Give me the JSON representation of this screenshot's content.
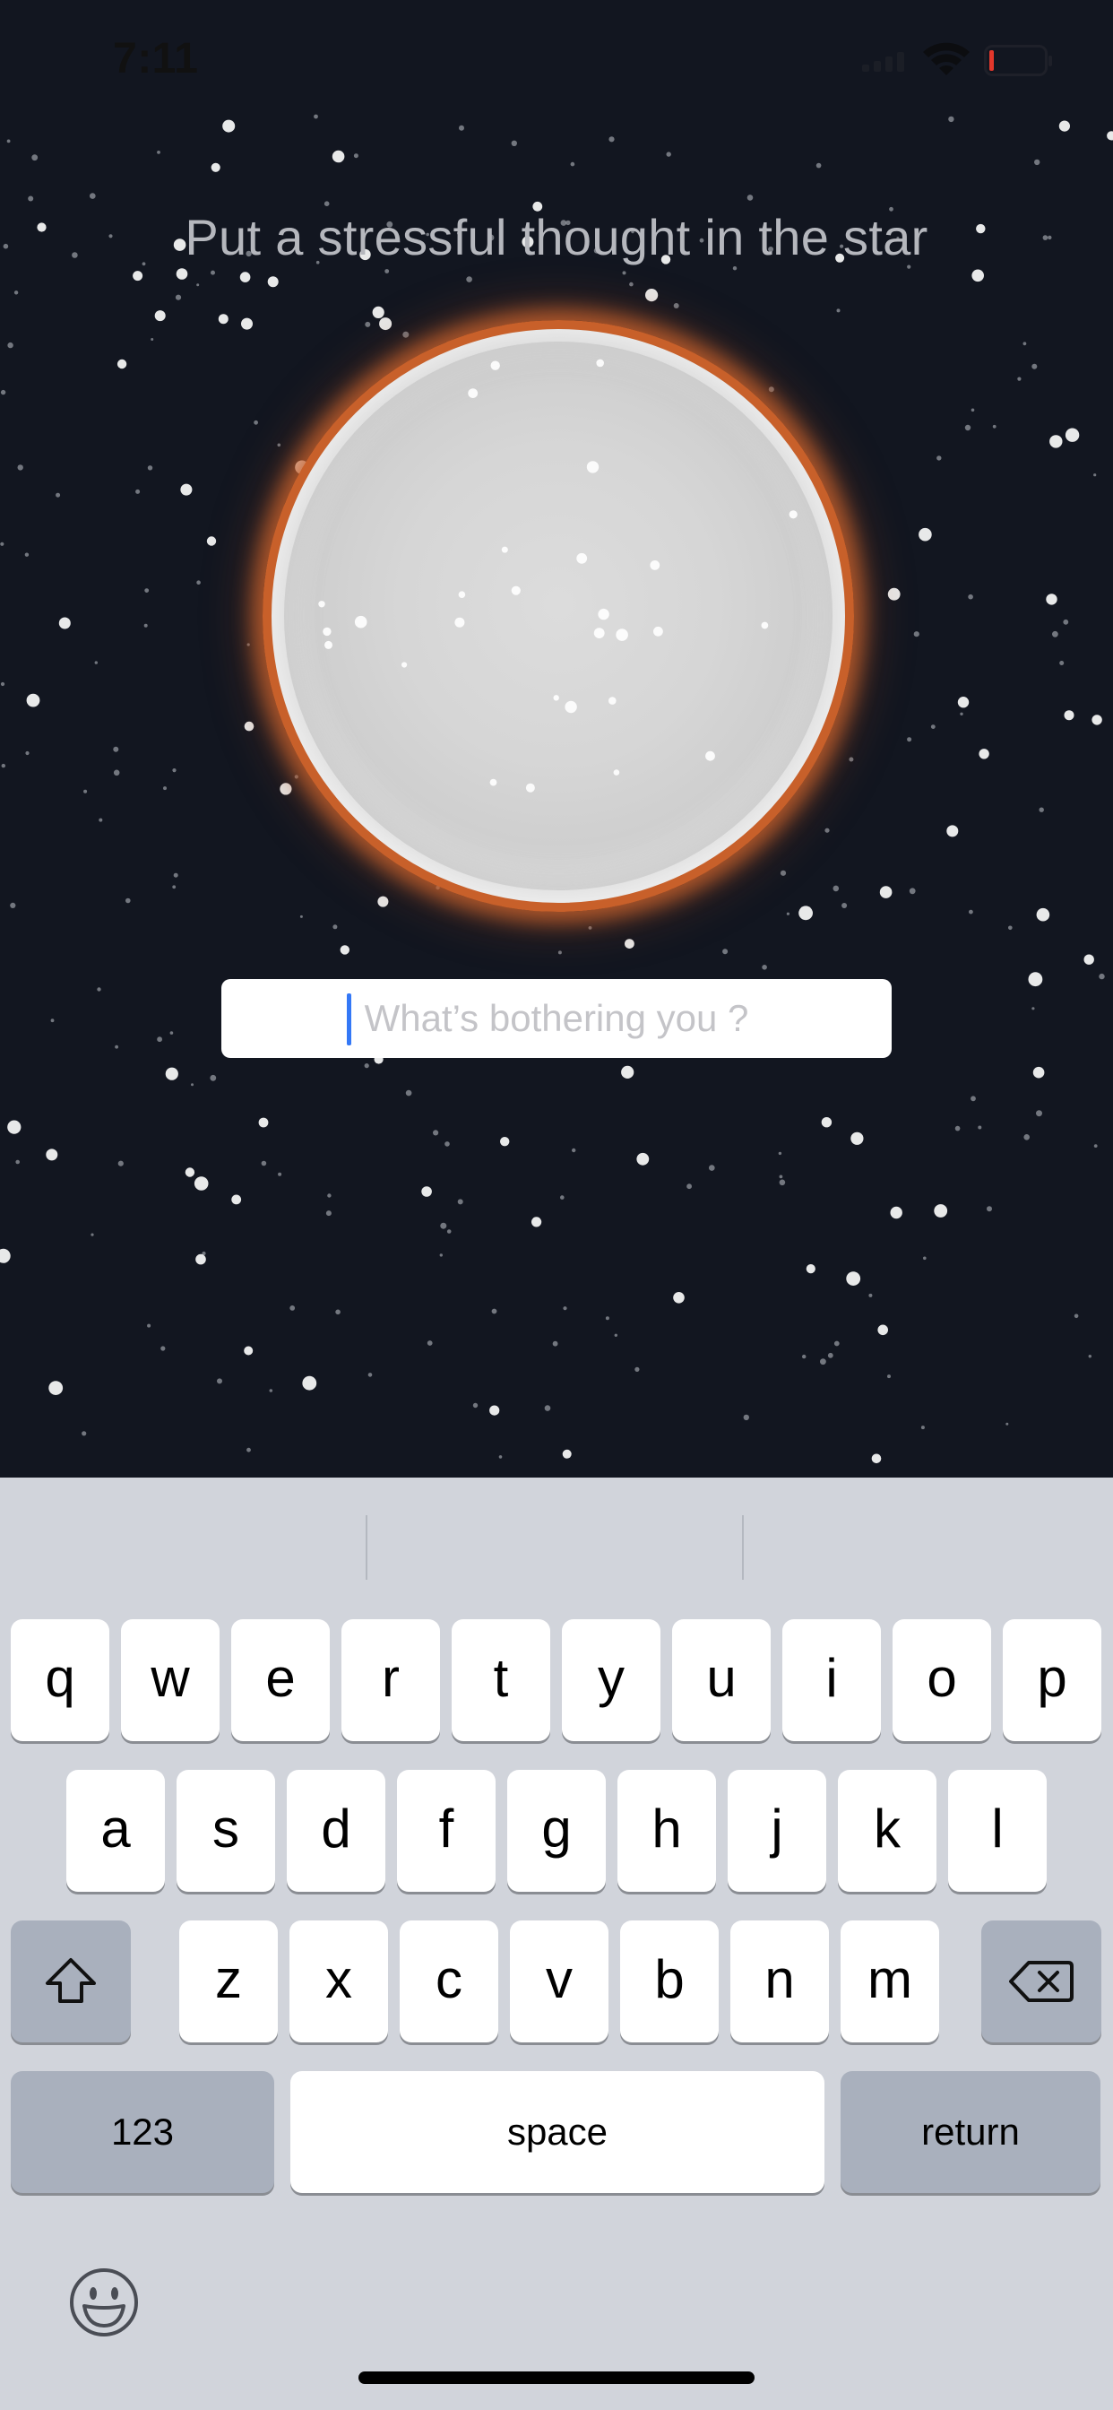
{
  "status_bar": {
    "time": "7:11"
  },
  "heading": "Put a stressful thought in the star",
  "thought_input": {
    "placeholder": "What’s bothering you ?",
    "value": ""
  },
  "colors": {
    "background": "#121620",
    "orb_glow": "#c8602a",
    "cursor": "#3478f6",
    "keyboard": "#d1d4db"
  },
  "keyboard": {
    "row1": [
      "q",
      "w",
      "e",
      "r",
      "t",
      "y",
      "u",
      "i",
      "o",
      "p"
    ],
    "row2": [
      "a",
      "s",
      "d",
      "f",
      "g",
      "h",
      "j",
      "k",
      "l"
    ],
    "row3": [
      "z",
      "x",
      "c",
      "v",
      "b",
      "n",
      "m"
    ],
    "numbers_label": "123",
    "space_label": "space",
    "return_label": "return",
    "shift_icon": "shift-arrow-icon",
    "delete_icon": "backspace-icon",
    "emoji_icon": "emoji-face-icon"
  }
}
